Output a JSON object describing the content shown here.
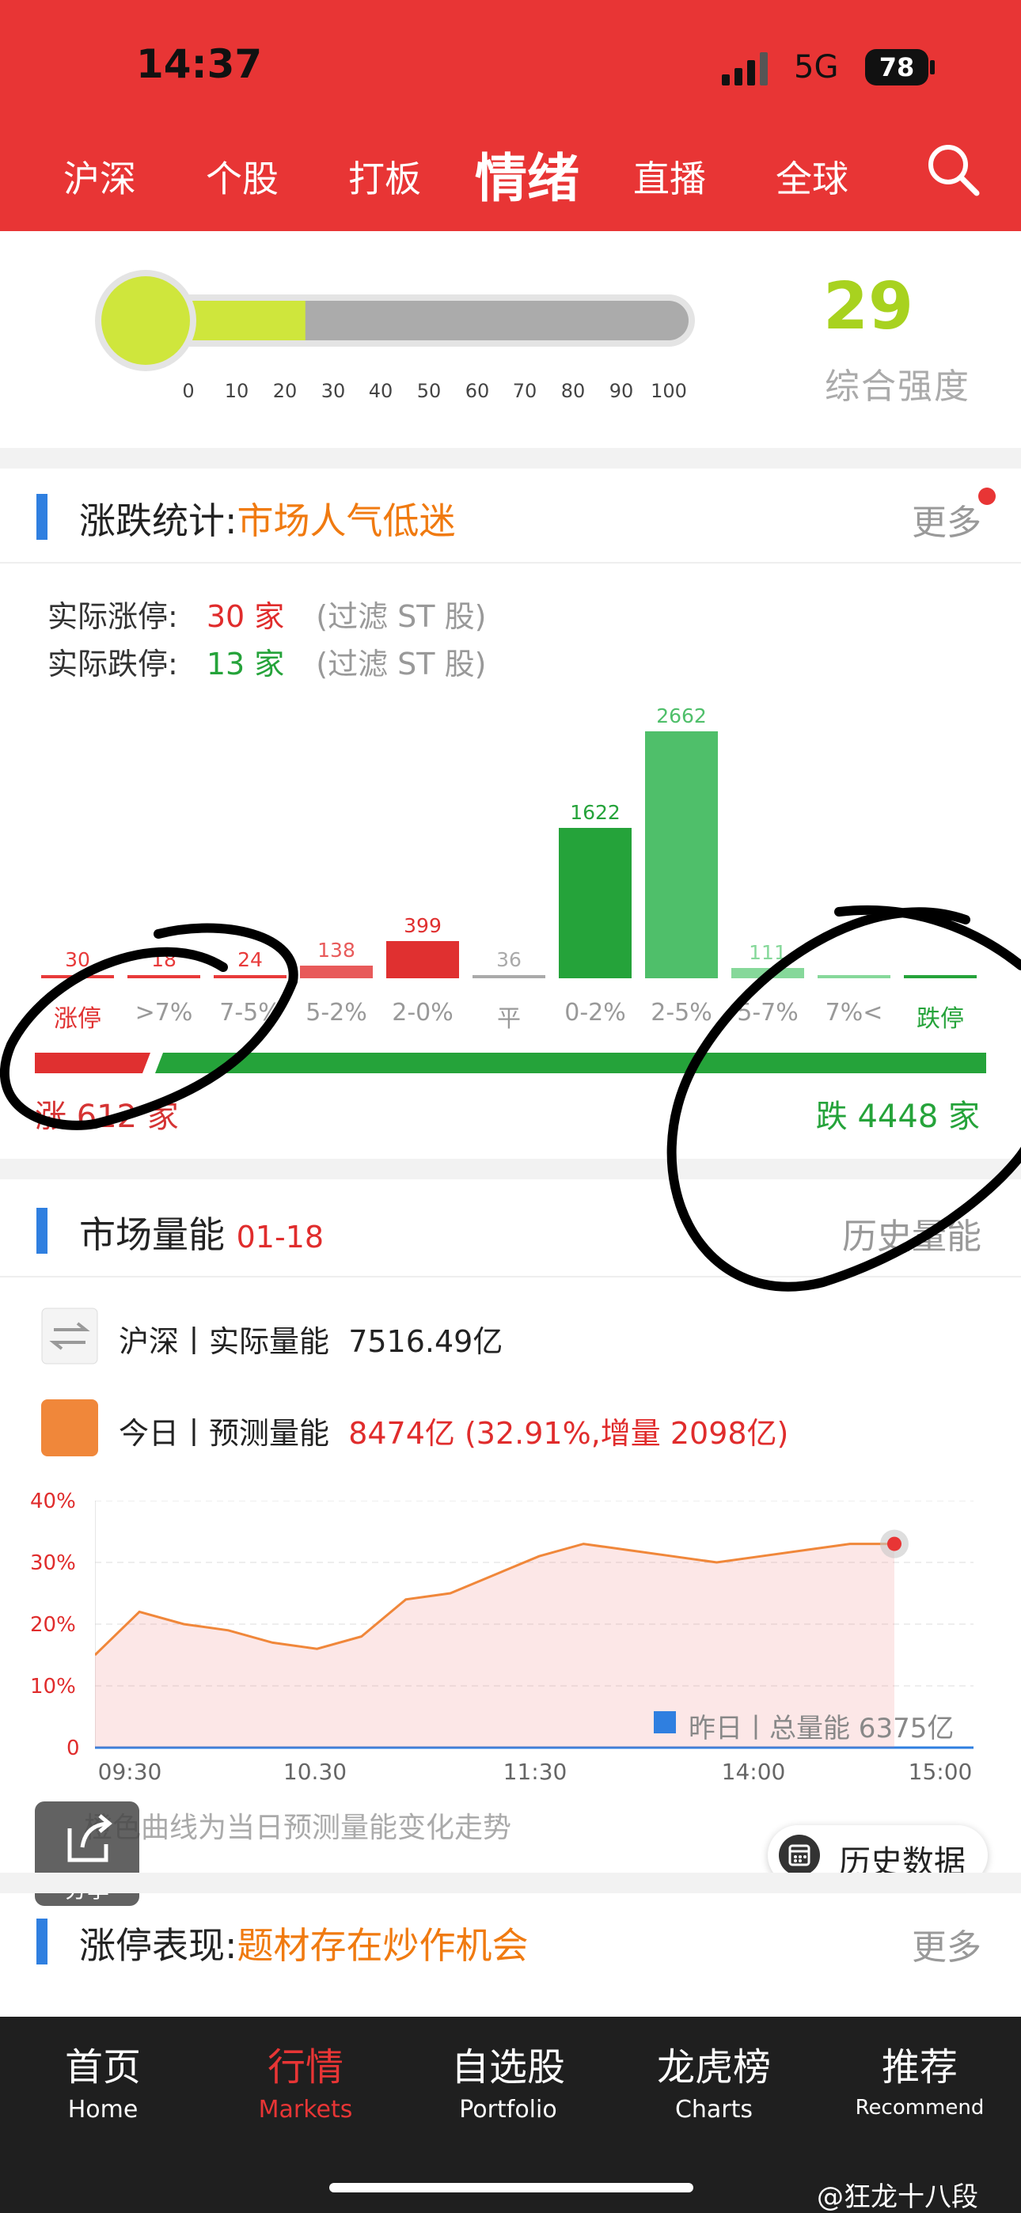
{
  "status": {
    "time": "14:37",
    "network": "5G",
    "battery": "78"
  },
  "nav": {
    "tabs": [
      "沪深",
      "个股",
      "打板",
      "情绪",
      "直播",
      "全球"
    ],
    "active": "情绪"
  },
  "gauge": {
    "ticks": [
      "0",
      "10",
      "20",
      "30",
      "40",
      "50",
      "60",
      "70",
      "80",
      "90",
      "100"
    ],
    "level": 29,
    "score": "29",
    "score_label": "综合强度",
    "fill_color": "#cfe63c"
  },
  "updown": {
    "title": "涨跌统计:",
    "mood": "市场人气低迷",
    "more": "更多",
    "limit_up_label": "实际涨停:",
    "limit_up_value": "30 家",
    "limit_up_note": "(过滤 ST 股)",
    "limit_down_label": "实际跌停:",
    "limit_down_value": "13 家",
    "limit_down_note": "(过滤 ST 股)",
    "summary_up": "涨 612 家",
    "summary_down": "跌 4448 家"
  },
  "chart_data": [
    {
      "type": "bar",
      "categories": [
        "涨停",
        ">7%",
        "7-5%",
        "5-2%",
        "2-0%",
        "平",
        "0-2%",
        "2-5%",
        "5-7%",
        "7%<",
        "跌停"
      ],
      "values": [
        30,
        18,
        24,
        138,
        399,
        36,
        1622,
        2662,
        111,
        30,
        13
      ],
      "value_labels": [
        "30",
        "18",
        "24",
        "138",
        "399",
        "36",
        "1622",
        "2662",
        "111",
        "",
        ""
      ],
      "colors": [
        "#e83a3a",
        "#e83a3a",
        "#e83a3a",
        "#e85a5a",
        "#e03030",
        "#aaaaaa",
        "#25a33a",
        "#4fbf6a",
        "#86d89a",
        "#86d89a",
        "#25a33a"
      ],
      "ylim": [
        0,
        2662
      ]
    },
    {
      "type": "area",
      "x": [
        "09:30",
        "09:40",
        "09:50",
        "10:00",
        "10:10",
        "10:20",
        "10:30",
        "10:45",
        "11:00",
        "11:15",
        "11:30",
        "11:45",
        "13:15",
        "13:30",
        "13:45",
        "14:00",
        "14:15",
        "14:30",
        "14:45"
      ],
      "y": [
        15,
        22,
        20,
        19,
        17,
        16,
        18,
        24,
        25,
        28,
        31,
        33,
        32,
        31,
        30,
        31,
        32,
        33,
        33
      ],
      "yticks": [
        "40%",
        "30%",
        "20%",
        "10%",
        "0"
      ],
      "xticks": [
        "09:30",
        "10.30",
        "11:30",
        "14:00",
        "15:00"
      ],
      "ylim": [
        0,
        40
      ],
      "legend": "昨日丨总量能 6375亿"
    }
  ],
  "volume": {
    "title": "市场量能",
    "date": "01-18",
    "history_link": "历史量能",
    "actual_label": "沪深丨实际量能",
    "actual_value": "7516.49亿",
    "forecast_label": "今日丨预测量能",
    "forecast_value": "8474亿 (32.91%,增量 2098亿)",
    "note": "橙色曲线为当日预测量能变化走势",
    "history_button": "历史数据",
    "share": "分享"
  },
  "limitup": {
    "title": "涨停表现:",
    "highlight": "题材存在炒作机会",
    "more": "更多"
  },
  "bottom_nav": [
    {
      "zh": "首页",
      "en": "Home"
    },
    {
      "zh": "行情",
      "en": "Markets"
    },
    {
      "zh": "自选股",
      "en": "Portfolio"
    },
    {
      "zh": "龙虎榜",
      "en": "Charts"
    },
    {
      "zh": "推荐",
      "en": "Recommend"
    }
  ],
  "watermark": "@狂龙十八段"
}
